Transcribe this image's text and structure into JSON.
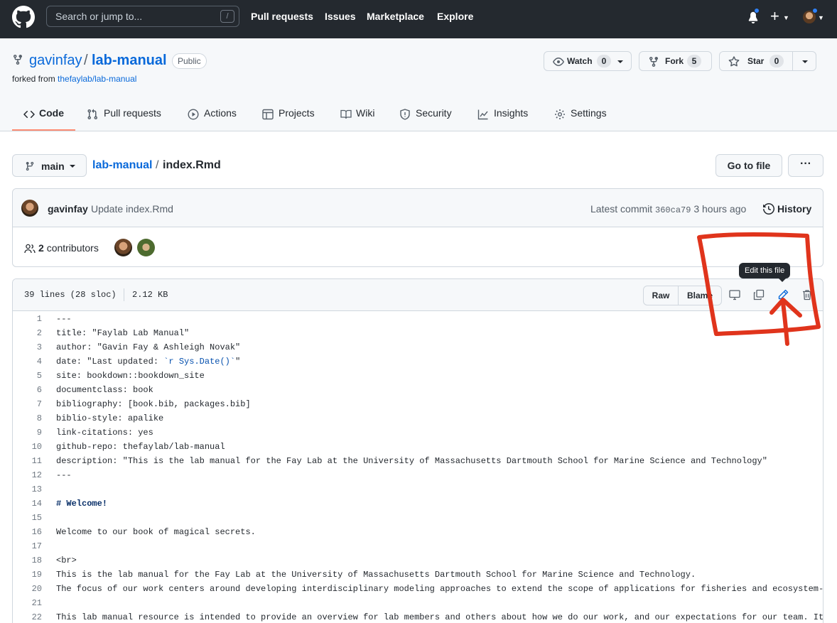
{
  "header": {
    "search_placeholder": "Search or jump to...",
    "search_shortcut": "/",
    "nav": [
      "Pull requests",
      "Issues",
      "Marketplace",
      "Explore"
    ],
    "plus": "+"
  },
  "repo": {
    "owner": "gavinfay",
    "separator": "/",
    "name": "lab-manual",
    "visibility": "Public",
    "forked_prefix": "forked from",
    "forked_from": "thefaylab/lab-manual",
    "watch_label": "Watch",
    "watch_count": "0",
    "fork_label": "Fork",
    "fork_count": "5",
    "star_label": "Star",
    "star_count": "0"
  },
  "tabs": [
    {
      "label": "Code",
      "icon": "code-icon",
      "selected": true
    },
    {
      "label": "Pull requests",
      "icon": "pull-request-icon"
    },
    {
      "label": "Actions",
      "icon": "play-icon"
    },
    {
      "label": "Projects",
      "icon": "table-icon"
    },
    {
      "label": "Wiki",
      "icon": "book-icon"
    },
    {
      "label": "Security",
      "icon": "shield-icon"
    },
    {
      "label": "Insights",
      "icon": "graph-icon"
    },
    {
      "label": "Settings",
      "icon": "gear-icon"
    }
  ],
  "path": {
    "branch": "main",
    "repo": "lab-manual",
    "separator": "/",
    "file": "index.Rmd",
    "goto_label": "Go to file",
    "more_label": "···"
  },
  "commit": {
    "author": "gavinfay",
    "message": "Update index.Rmd",
    "latest_prefix": "Latest commit",
    "sha": "360ca79",
    "time": "3 hours ago",
    "history_label": "History",
    "contributors_count": "2",
    "contributors_label": "contributors"
  },
  "file": {
    "lines_info": "39 lines (28 sloc)",
    "size": "2.12 KB",
    "raw_label": "Raw",
    "blame_label": "Blame",
    "tooltip": "Edit this file",
    "lines": [
      "---",
      "title: \"Faylab Lab Manual\"",
      "author: \"Gavin Fay & Ashleigh Novak\"",
      "date: \"Last updated: ",
      "site: bookdown::bookdown_site",
      "documentclass: book",
      "bibliography: [book.bib, packages.bib]",
      "biblio-style: apalike",
      "link-citations: yes",
      "github-repo: thefaylab/lab-manual",
      "description: \"This is the lab manual for the Fay Lab at the University of Massachusetts Dartmouth School for Marine Science and Technology\"",
      "---",
      "",
      "# Welcome!",
      "",
      "Welcome to our book of magical secrets.",
      "",
      "<br>",
      "This is the lab manual for the Fay Lab at the University of Massachusetts Dartmouth School for Marine Science and Technology.",
      "The focus of our work centers around developing interdisciplinary modeling approaches to extend the scope of applications for fisheries and ecosystem-",
      "",
      "This lab manual resource is intended to provide an overview for lab members and others about how we do our work, and our expectations for our team. It"
    ],
    "line4_code": "`r Sys.Date()`",
    "line4_end": "\""
  },
  "colors": {
    "header_bg": "#24292f",
    "link": "#0969da",
    "tab_underline": "#fd8c73",
    "annotation": "#e0341c"
  }
}
